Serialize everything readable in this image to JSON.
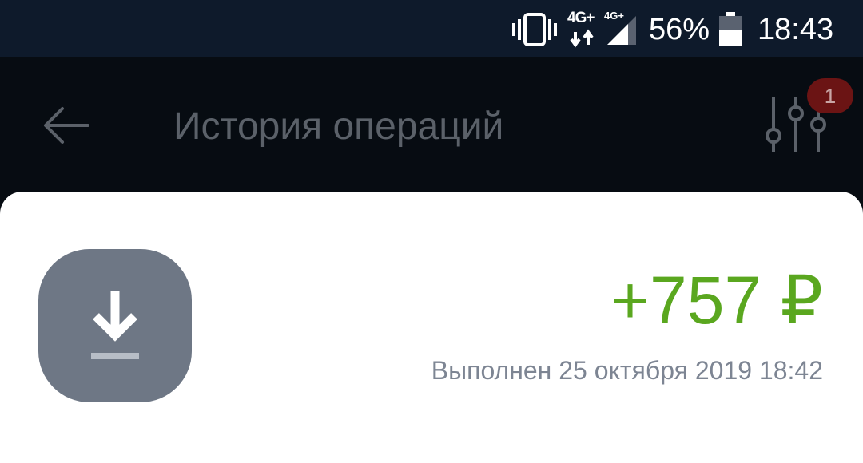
{
  "status_bar": {
    "network_left": "4G+",
    "network_right": "4G+",
    "battery_percent": "56%",
    "time": "18:43",
    "icons": [
      "vibrate-icon",
      "data-arrows-icon",
      "signal-icon",
      "battery-icon"
    ]
  },
  "app_bar": {
    "title": "История операций",
    "back_icon": "arrow-left-icon",
    "filter_icon": "sliders-icon",
    "filter_badge": "1"
  },
  "operation": {
    "icon": "download-icon",
    "amount": "+757 ₽",
    "status": "Выполнен 25 октября 2019 18:42"
  },
  "colors": {
    "status_bar_bg": "#0e1a2b",
    "app_bar_bg": "#070c12",
    "amount_green": "#5aa71f",
    "icon_tile": "#6e7785",
    "badge_red": "#6b1414"
  }
}
